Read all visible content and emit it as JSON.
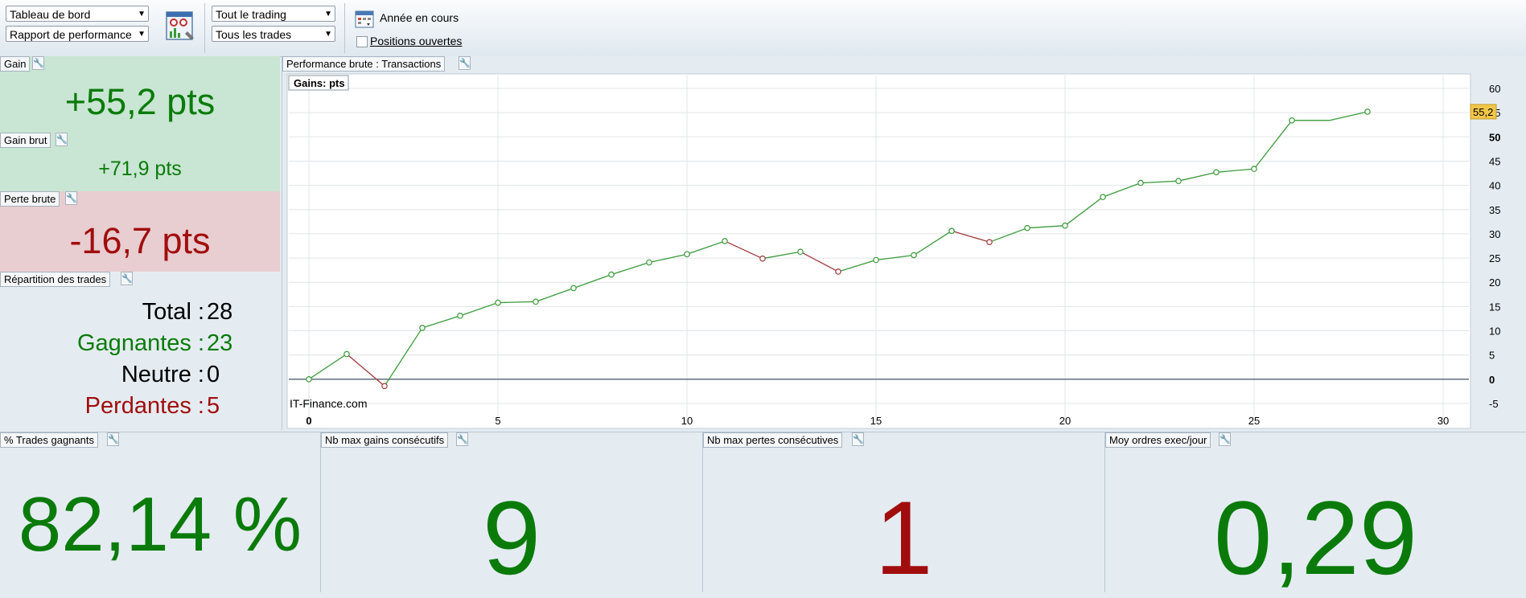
{
  "toolbar": {
    "view_select": "Tableau de bord",
    "report_select": "Rapport de performance",
    "scope_select": "Tout le trading",
    "trades_select": "Tous les trades",
    "period_label": "Année en cours",
    "open_positions_label": "Positions ouvertes",
    "open_positions_checked": false
  },
  "gain": {
    "title": "Gain",
    "value": "+55,2 pts"
  },
  "gain_brut": {
    "title": "Gain brut",
    "value": "+71,9 pts"
  },
  "perte_brute": {
    "title": "Perte brute",
    "value": "-16,7 pts"
  },
  "repartition": {
    "title": "Répartition des trades",
    "rows": [
      {
        "label": "Total :",
        "value": "28"
      },
      {
        "label": "Gagnantes :",
        "value": "23"
      },
      {
        "label": "Neutre :",
        "value": "0"
      },
      {
        "label": "Perdantes :",
        "value": "5"
      }
    ]
  },
  "chart_panel": {
    "title": "Performance brute : Transactions"
  },
  "chart_data": {
    "type": "line",
    "title": "Gains: pts",
    "watermark": "IT-Finance.com",
    "last_value_label": "55,2",
    "xlim": [
      0,
      30
    ],
    "ylim": [
      -5,
      60
    ],
    "x_ticks": [
      0,
      5,
      10,
      15,
      20,
      25,
      30
    ],
    "y_ticks": [
      -5,
      0,
      5,
      10,
      15,
      20,
      25,
      30,
      35,
      40,
      45,
      50,
      55,
      60
    ],
    "x_tick_labels": [
      "0",
      "5",
      "10",
      "15",
      "20",
      "25",
      "30"
    ],
    "y_tick_labels": [
      "-5",
      "0",
      "5",
      "10",
      "15",
      "20",
      "25",
      "30",
      "35",
      "40",
      "45",
      "50",
      "55",
      "60"
    ],
    "x": [
      0,
      1,
      2,
      3,
      4,
      5,
      6,
      7,
      8,
      9,
      10,
      11,
      12,
      13,
      14,
      15,
      16,
      17,
      18,
      19,
      20,
      21,
      22,
      23,
      24,
      25,
      26,
      27,
      28
    ],
    "y": [
      0,
      5.2,
      -1.4,
      10.6,
      13.1,
      15.8,
      16.0,
      18.8,
      21.6,
      24.1,
      25.8,
      28.5,
      24.9,
      26.3,
      22.2,
      24.6,
      25.6,
      30.6,
      28.3,
      31.2,
      31.7,
      37.6,
      40.5,
      40.9,
      42.7,
      43.4,
      53.4,
      53.4,
      55.2
    ],
    "line_color_gain": "#3a9a3a",
    "line_color_loss": "#a03a3a",
    "zero_line_color": "#556070",
    "grid": true
  },
  "stats": [
    {
      "title": "% Trades gagnants",
      "value": "82,14 %",
      "color": "green"
    },
    {
      "title": "Nb max gains consécutifs",
      "value": "9",
      "color": "green"
    },
    {
      "title": "Nb max pertes consécutives",
      "value": "1",
      "color": "red"
    },
    {
      "title": "Moy ordres exec/jour",
      "value": "0,29",
      "color": "green"
    }
  ],
  "icons": {
    "dashboard": "dashboard-settings-icon",
    "calendar": "calendar-icon",
    "wrench": "wrench-icon"
  }
}
